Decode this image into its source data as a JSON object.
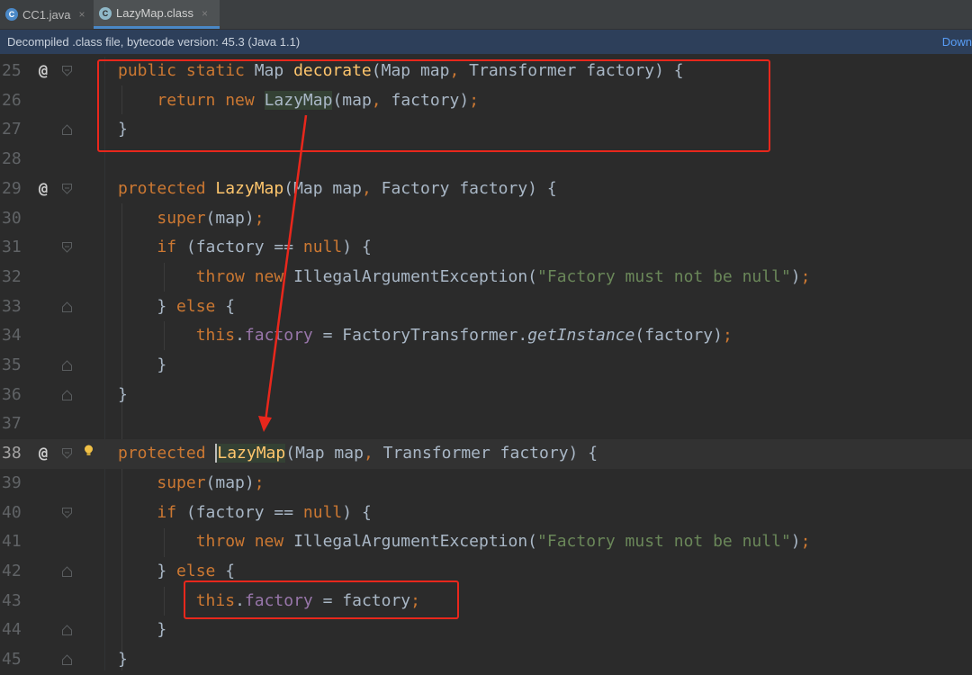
{
  "tabs": [
    {
      "label": "CC1.java",
      "icon": "java-class-icon",
      "icon_glyph": "C",
      "icon_color": "#4a88c7",
      "active": false
    },
    {
      "label": "LazyMap.class",
      "icon": "compiled-class-icon",
      "icon_glyph": "C",
      "icon_color": "#8fb8c8",
      "active": true
    }
  ],
  "tab_close_glyph": "×",
  "banner": {
    "text": "Decompiled .class file, bytecode version: 45.3 (Java 1.1)",
    "link": "Down"
  },
  "colors": {
    "keyword": "#cc7832",
    "method": "#ffc66d",
    "string": "#6a8759",
    "field": "#9876aa",
    "annotation_box": "#e8271c",
    "reference_highlight": "#344134"
  },
  "editor": {
    "current_line": "38",
    "lines": [
      {
        "n": "25",
        "ann": "@",
        "text": "public static Map decorate(Map map, Transformer factory) {"
      },
      {
        "n": "26",
        "ann": "",
        "text": "return new LazyMap(map, factory);"
      },
      {
        "n": "27",
        "ann": "",
        "text": "}"
      },
      {
        "n": "28",
        "ann": "",
        "text": ""
      },
      {
        "n": "29",
        "ann": "@",
        "text": "protected LazyMap(Map map, Factory factory) {"
      },
      {
        "n": "30",
        "ann": "",
        "text": "super(map);"
      },
      {
        "n": "31",
        "ann": "",
        "text": "if (factory == null) {"
      },
      {
        "n": "32",
        "ann": "",
        "text": "throw new IllegalArgumentException(\"Factory must not be null\");"
      },
      {
        "n": "33",
        "ann": "",
        "text": "} else {"
      },
      {
        "n": "34",
        "ann": "",
        "text": "this.factory = FactoryTransformer.getInstance(factory);"
      },
      {
        "n": "35",
        "ann": "",
        "text": "}"
      },
      {
        "n": "36",
        "ann": "",
        "text": "}"
      },
      {
        "n": "37",
        "ann": "",
        "text": ""
      },
      {
        "n": "38",
        "ann": "@",
        "text": "protected LazyMap(Map map, Transformer factory) {"
      },
      {
        "n": "39",
        "ann": "",
        "text": "super(map);"
      },
      {
        "n": "40",
        "ann": "",
        "text": "if (factory == null) {"
      },
      {
        "n": "41",
        "ann": "",
        "text": "throw new IllegalArgumentException(\"Factory must not be null\");"
      },
      {
        "n": "42",
        "ann": "",
        "text": "} else {"
      },
      {
        "n": "43",
        "ann": "",
        "text": "this.factory = factory;"
      },
      {
        "n": "44",
        "ann": "",
        "text": "}"
      },
      {
        "n": "45",
        "ann": "",
        "text": "}"
      }
    ]
  }
}
